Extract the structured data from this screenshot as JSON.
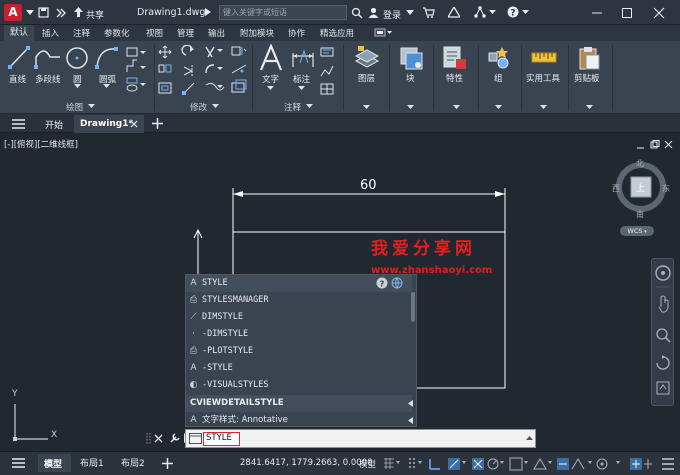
{
  "titlebar": {
    "app_logo": "A",
    "share_label": "共享",
    "file_name": "Drawing1.dwg",
    "search_placeholder": "键入关键字或短语",
    "login_label": "登录"
  },
  "menu": {
    "tabs": [
      "默认",
      "插入",
      "注释",
      "参数化",
      "视图",
      "管理",
      "输出",
      "附加模块",
      "协作",
      "精选应用"
    ]
  },
  "ribbon": {
    "draw": {
      "line": "直线",
      "polyline": "多段线",
      "circle": "圆",
      "arc": "圆弧",
      "panel": "绘图"
    },
    "modify": {
      "panel": "修改"
    },
    "annotation": {
      "text": "文字",
      "dimension": "标注",
      "panel": "注释"
    },
    "layers": "图层",
    "block": "块",
    "properties": "特性",
    "group": "组",
    "utilities": "实用工具",
    "clipboard": "剪贴板"
  },
  "filetabs": {
    "start": "开始",
    "drawing": "Drawing1*"
  },
  "viewport": {
    "label": "[-][俯视][二维线框]",
    "dimension_value": "60",
    "ucs_y": "Y",
    "ucs_x": "X"
  },
  "navcube": {
    "north": "北",
    "south": "南",
    "east": "东",
    "west": "西",
    "top": "上",
    "wcs": "WCS"
  },
  "autocomplete": {
    "items": [
      "STYLE",
      "STYLESMANAGER",
      "DIMSTYLE",
      "-DIMSTYLE",
      "-PLOTSTYLE",
      "-STYLE",
      "-VISUALSTYLES"
    ],
    "group1": "CVIEWDETAILSTYLE",
    "group2": "文字样式: Annotative"
  },
  "command": {
    "input": "STYLE"
  },
  "watermark": {
    "title": "我爱分享网",
    "url": "www.zhanshaoyi.com"
  },
  "statusbar": {
    "model_tab": "模型",
    "layout1": "布局1",
    "layout2": "布局2",
    "coordinates": "2841.6417, 1779.2663, 0.0000",
    "model_label": "模型"
  }
}
